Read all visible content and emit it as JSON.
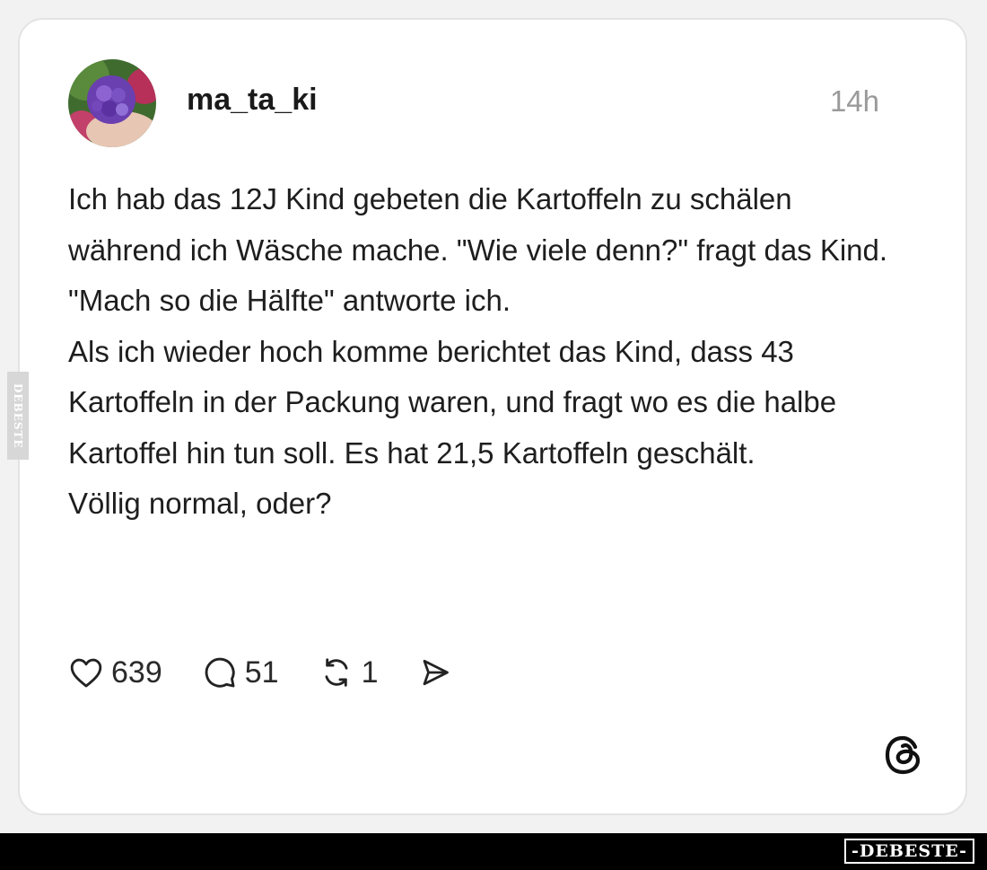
{
  "post": {
    "username": "ma_ta_ki",
    "time": "14h",
    "avatar_icon": "hydrangea-flower-photo",
    "paragraphs": [
      "Ich hab das 12J Kind gebeten die Kartoffeln zu schälen während ich Wäsche mache. \"Wie viele denn?\" fragt das Kind. \"Mach so die Hälfte\" antworte ich.",
      "Als ich wieder hoch komme berichtet das Kind, dass 43 Kartoffeln in der Packung waren, und fragt wo es die halbe Kartoffel hin tun soll. Es hat 21,5 Kartoffeln geschält.",
      "Völlig normal, oder?"
    ]
  },
  "actions": {
    "like": {
      "icon": "heart-icon",
      "count": "639"
    },
    "comment": {
      "icon": "comment-bubble-icon",
      "count": "51"
    },
    "repost": {
      "icon": "repost-icon",
      "count": "1"
    },
    "share": {
      "icon": "send-icon"
    }
  },
  "branding": {
    "threads_logo": "threads-logo-icon",
    "side_watermark": "DEBESTE",
    "footer_badge": "-DEBESTE-"
  },
  "colors": {
    "background": "#f2f2f2",
    "card": "#ffffff",
    "text": "#1e1e1e",
    "muted": "#9a9a9a",
    "footer": "#000000"
  }
}
